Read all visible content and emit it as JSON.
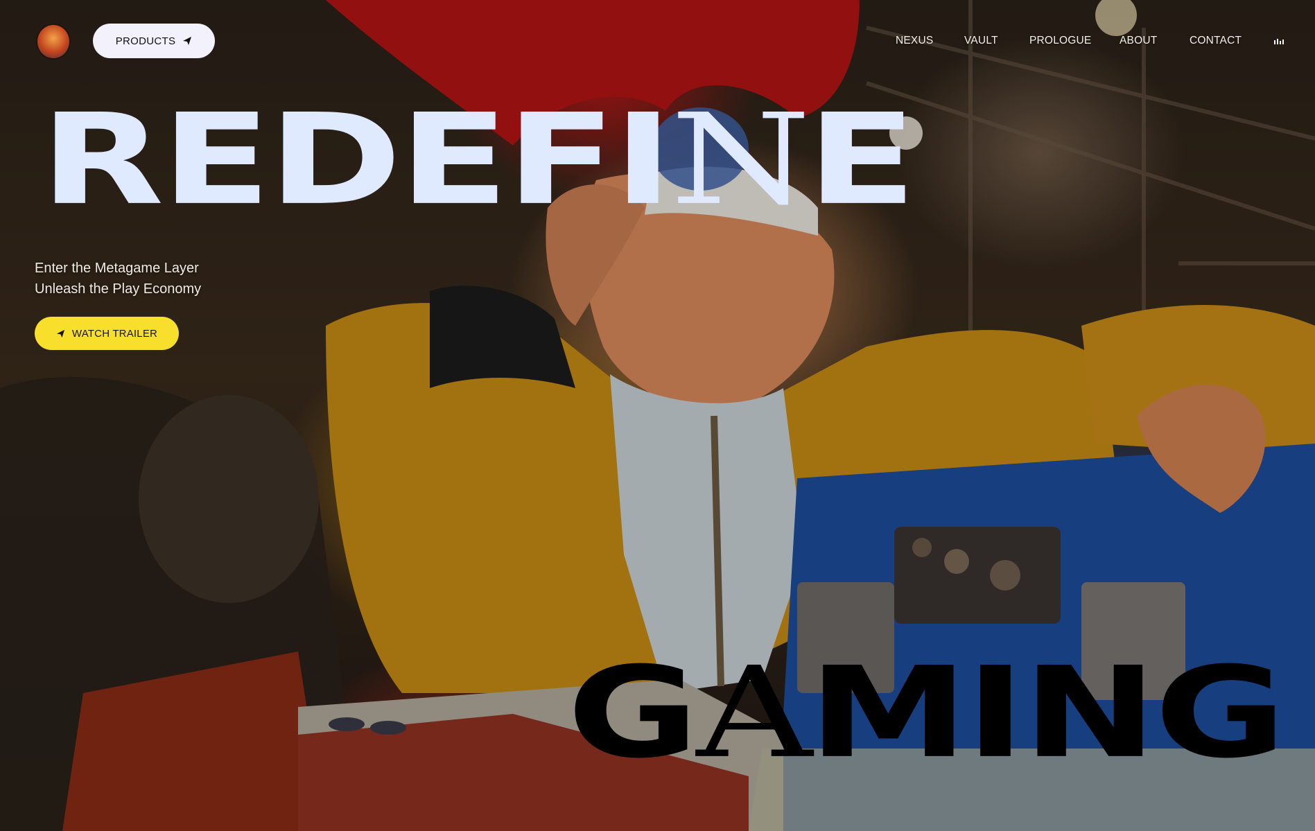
{
  "header": {
    "products_label": "PRODUCTS",
    "nav": [
      "NEXUS",
      "VAULT",
      "PROLOGUE",
      "ABOUT",
      "CONTACT"
    ]
  },
  "hero": {
    "title_part1": "REDEFI",
    "title_serif": "N",
    "title_part2": "E",
    "tagline_line1": "Enter the Metagame Layer",
    "tagline_line2": "Unleash the Play Economy",
    "trailer_label": "WATCH TRAILER",
    "bottom_part1": "G",
    "bottom_serif": "A",
    "bottom_part2": "MING"
  },
  "colors": {
    "hero_text": "#dfe9ff",
    "trailer_button": "#f7df2c",
    "products_button": "#f3f1fb"
  },
  "icons": [
    "logo-avatar",
    "send-arrow-icon",
    "audio-bars-icon"
  ]
}
